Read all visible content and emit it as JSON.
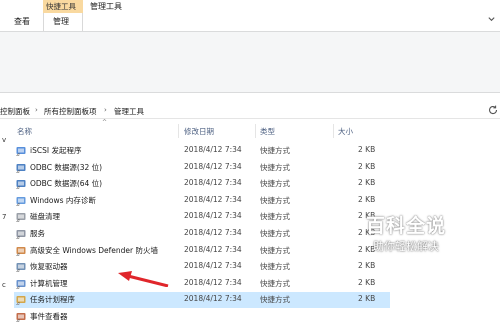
{
  "ribbon": {
    "context_group_label": "快捷工具",
    "window_title": "管理工具",
    "tabs": [
      {
        "label": "查看"
      },
      {
        "label": "管理"
      }
    ]
  },
  "address": {
    "breadcrumbs": [
      "控制面板",
      "所有控制面板项",
      "管理工具"
    ]
  },
  "columns": {
    "name": "名称",
    "date": "修改日期",
    "type": "类型",
    "size": "大小"
  },
  "rows": [
    {
      "name": "iSCSI 发起程序",
      "date": "2018/4/12 7:34",
      "type": "快捷方式",
      "size": "2 KB",
      "icon": "iscsi-icon"
    },
    {
      "name": "ODBC 数据源(32 位)",
      "date": "2018/4/12 7:34",
      "type": "快捷方式",
      "size": "2 KB",
      "icon": "odbc-icon"
    },
    {
      "name": "ODBC 数据源(64 位)",
      "date": "2018/4/12 7:34",
      "type": "快捷方式",
      "size": "2 KB",
      "icon": "odbc-icon"
    },
    {
      "name": "Windows 内存诊断",
      "date": "2018/4/12 7:34",
      "type": "快捷方式",
      "size": "2 KB",
      "icon": "memory-diagnostic-icon"
    },
    {
      "name": "磁盘清理",
      "date": "2018/4/12 7:34",
      "type": "快捷方式",
      "size": "2 KB",
      "icon": "disk-cleanup-icon"
    },
    {
      "name": "服务",
      "date": "2018/4/12 7:34",
      "type": "快捷方式",
      "size": "2 KB",
      "icon": "services-icon"
    },
    {
      "name": "高级安全 Windows Defender 防火墙",
      "date": "2018/4/12 7:34",
      "type": "快捷方式",
      "size": "2 KB",
      "icon": "firewall-icon"
    },
    {
      "name": "恢复驱动器",
      "date": "2018/4/12 7:34",
      "type": "快捷方式",
      "size": "2 KB",
      "icon": "recovery-drive-icon"
    },
    {
      "name": "计算机管理",
      "date": "2018/4/12 7:34",
      "type": "快捷方式",
      "size": "2 KB",
      "icon": "computer-management-icon"
    },
    {
      "name": "任务计划程序",
      "date": "2018/4/12 7:34",
      "type": "快捷方式",
      "size": "2 KB",
      "icon": "task-scheduler-icon",
      "selected": true
    },
    {
      "name": "事件查看器",
      "date": "",
      "type": "",
      "size": "",
      "icon": "event-viewer-icon"
    }
  ],
  "left_pane_marks": [
    "v",
    "7",
    "c"
  ],
  "watermark": {
    "title": "百科全说",
    "subtitle": "助你轻松解决"
  },
  "colors": {
    "context_tab": "#f9d9a0",
    "selection": "#cce8ff",
    "annotation_arrow": "#e0262b",
    "header_text": "#4d6082"
  }
}
